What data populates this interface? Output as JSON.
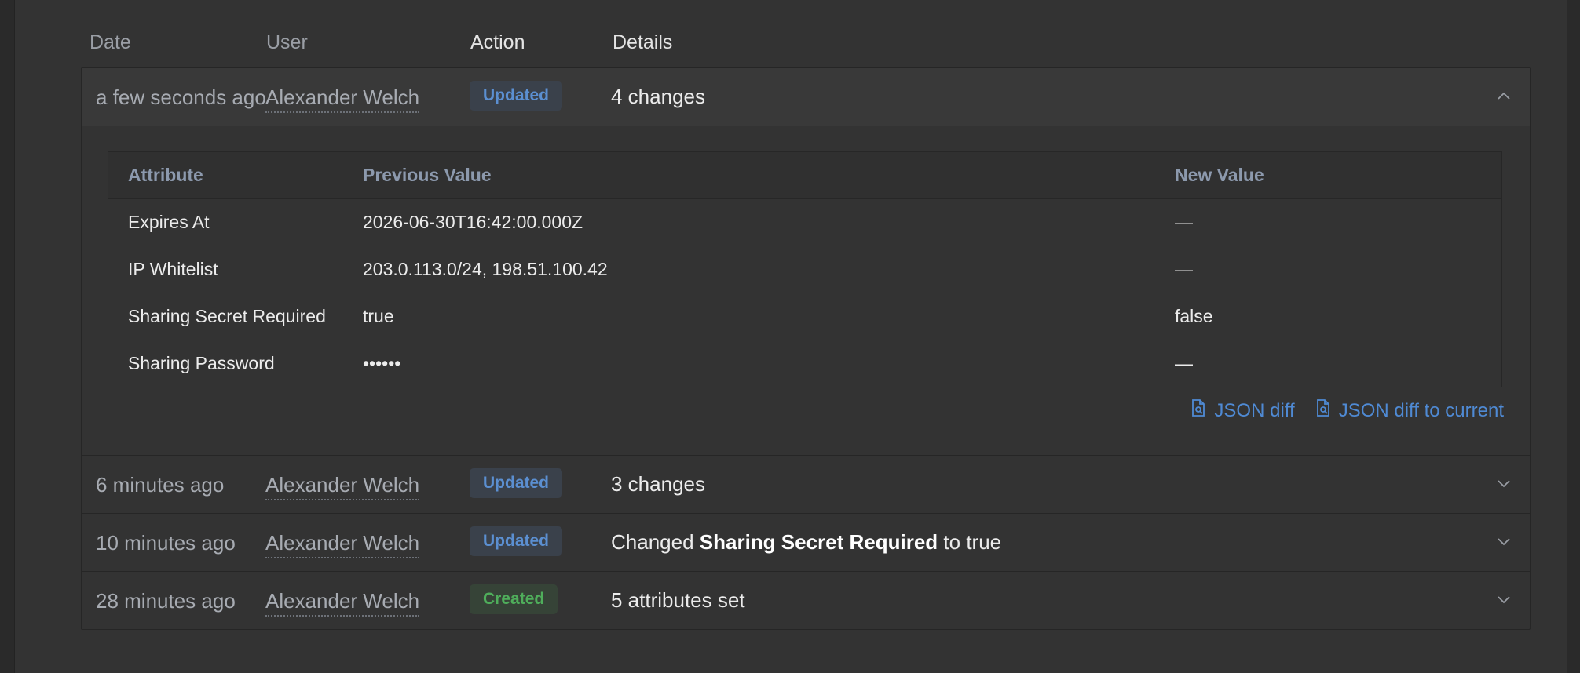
{
  "columns": {
    "date": "Date",
    "user": "User",
    "action": "Action",
    "details": "Details"
  },
  "entries": [
    {
      "date": "a few seconds ago",
      "user": "Alexander Welch",
      "action": "Updated",
      "details": "4 changes",
      "expanded": true,
      "diff": {
        "headers": {
          "attribute": "Attribute",
          "previous": "Previous Value",
          "new": "New Value"
        },
        "rows": [
          {
            "attribute": "Expires At",
            "previous": "2026-06-30T16:42:00.000Z",
            "new": "—"
          },
          {
            "attribute": "IP Whitelist",
            "previous": "203.0.113.0/24, 198.51.100.42",
            "new": "—"
          },
          {
            "attribute": "Sharing Secret Required",
            "previous": "true",
            "new": "false"
          },
          {
            "attribute": "Sharing Password",
            "previous": "••••••",
            "new": "—"
          }
        ]
      },
      "links": {
        "json_diff": "JSON diff",
        "json_diff_current": "JSON diff to current"
      }
    },
    {
      "date": "6 minutes ago",
      "user": "Alexander Welch",
      "action": "Updated",
      "details": "3 changes",
      "expanded": false
    },
    {
      "date": "10 minutes ago",
      "user": "Alexander Welch",
      "action": "Updated",
      "details_prefix": "Changed ",
      "details_bold": "Sharing Secret Required",
      "details_suffix": " to true",
      "expanded": false
    },
    {
      "date": "28 minutes ago",
      "user": "Alexander Welch",
      "action": "Created",
      "details": "5 attributes set",
      "expanded": false
    }
  ],
  "colors": {
    "updated_badge": "#5b8fd1",
    "created_badge": "#4fae5b",
    "link": "#4f8ad4"
  },
  "icons": {
    "expanded": "chevron-up-icon",
    "collapsed": "chevron-down-icon",
    "json": "file-search-icon"
  }
}
